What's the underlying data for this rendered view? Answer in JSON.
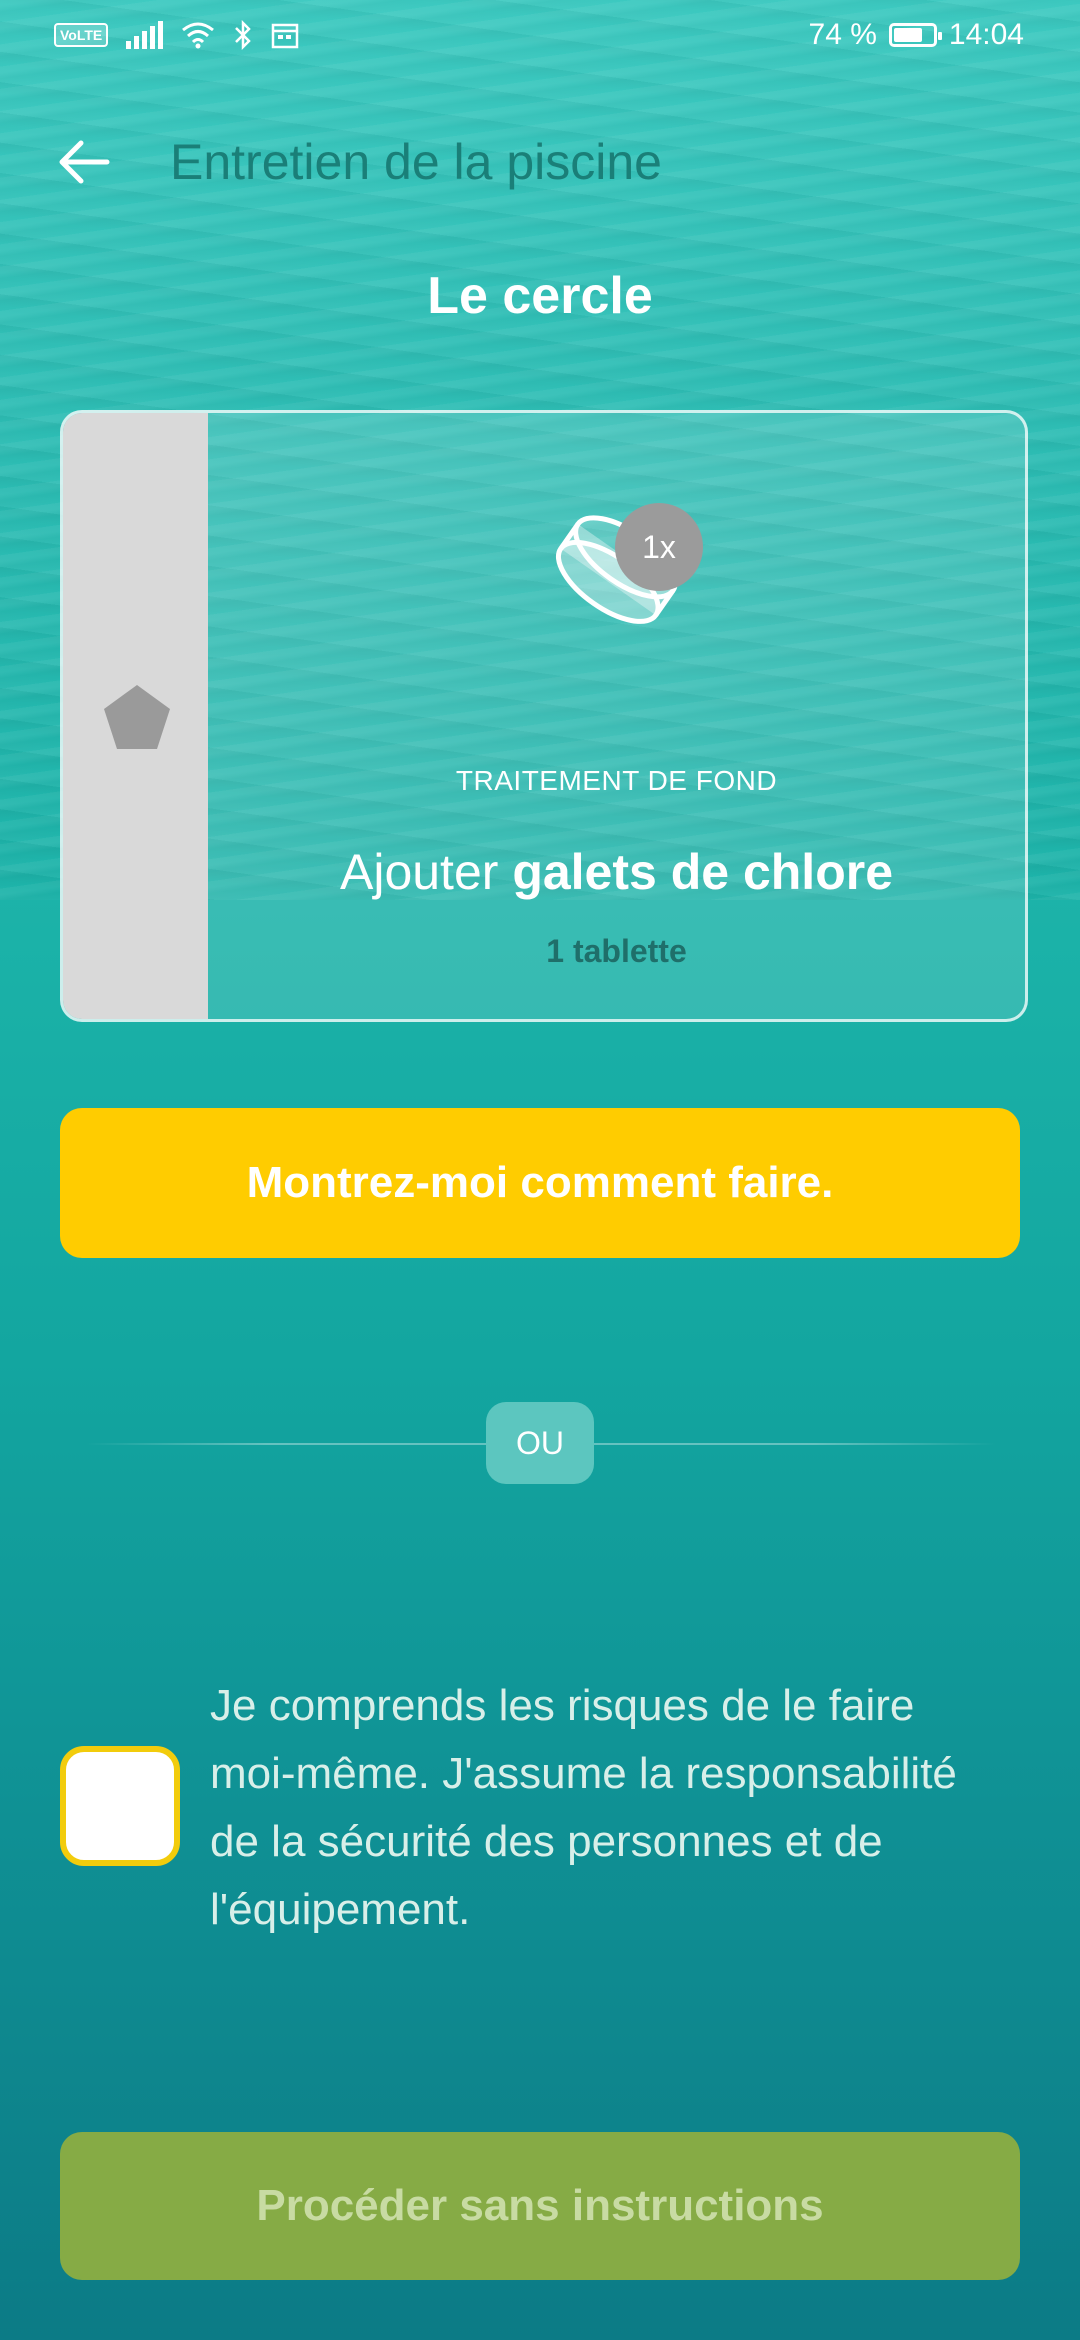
{
  "status_bar": {
    "volte": "VoLTE",
    "battery": "74 %",
    "battery_level": 0.74,
    "time": "14:04"
  },
  "header": {
    "title": "Entretien de la piscine",
    "section_title": "Le cercle"
  },
  "step_card": {
    "quantity_badge": "1x",
    "category": "TRAITEMENT DE FOND",
    "action_prefix": "Ajouter ",
    "action_product": "galets de chlore",
    "quantity": "1 tablette",
    "rail_icon": "pentagon-icon",
    "item_icon": "chlorine-tablet-icon"
  },
  "buttons": {
    "show_me": "Montrez-moi comment faire.",
    "proceed": "Procéder sans instructions"
  },
  "divider": {
    "label": "OU"
  },
  "consent": {
    "text": "Je comprends les risques de le faire moi-même. J'assume la responsabilité de la sécurité des personnes et de l'équipement.",
    "checked": false
  },
  "colors": {
    "accent_yellow": "#ffcc00",
    "proceed_green": "#86ab45",
    "title_teal": "#1a7f78"
  }
}
